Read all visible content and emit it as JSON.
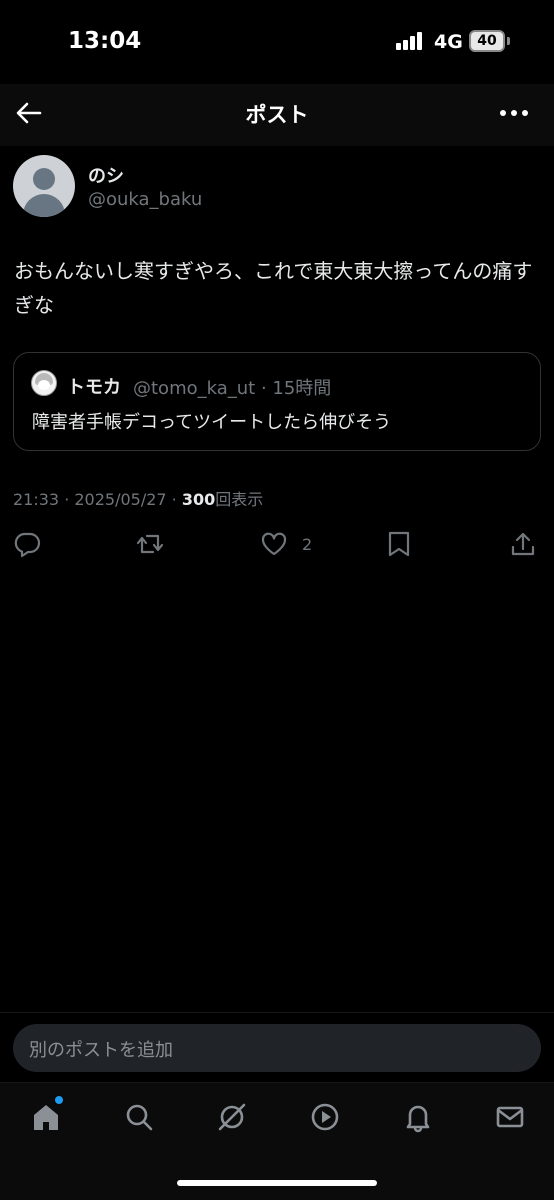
{
  "status": {
    "time": "13:04",
    "network": "4G",
    "battery": "40"
  },
  "nav": {
    "title": "ポスト",
    "back_icon": "arrow-left-icon",
    "more_icon": "more-horizontal-icon"
  },
  "post": {
    "display_name": "のシ",
    "handle": "@ouka_baku",
    "text": "おもんないし寒すぎやろ、これで東大東大擦ってんの痛すぎな",
    "timestamp": "21:33 · 2025/05/27 · ",
    "view_count": "300",
    "view_label": "回表示"
  },
  "quote": {
    "display_name": "トモカ",
    "handle": "@tomo_ka_ut · 15時間",
    "text": "障害者手帳デコってツイートしたら伸びそう"
  },
  "actions": {
    "like_count": "2"
  },
  "reply": {
    "placeholder": "別のポストを追加"
  },
  "tabs": [
    "home-icon",
    "search-icon",
    "grok-icon",
    "video-icon",
    "bell-icon",
    "mail-icon"
  ],
  "colors": {
    "background": "#000000",
    "accent": "#1d9bf0",
    "muted": "#71767b",
    "text": "#e7e9ea"
  }
}
